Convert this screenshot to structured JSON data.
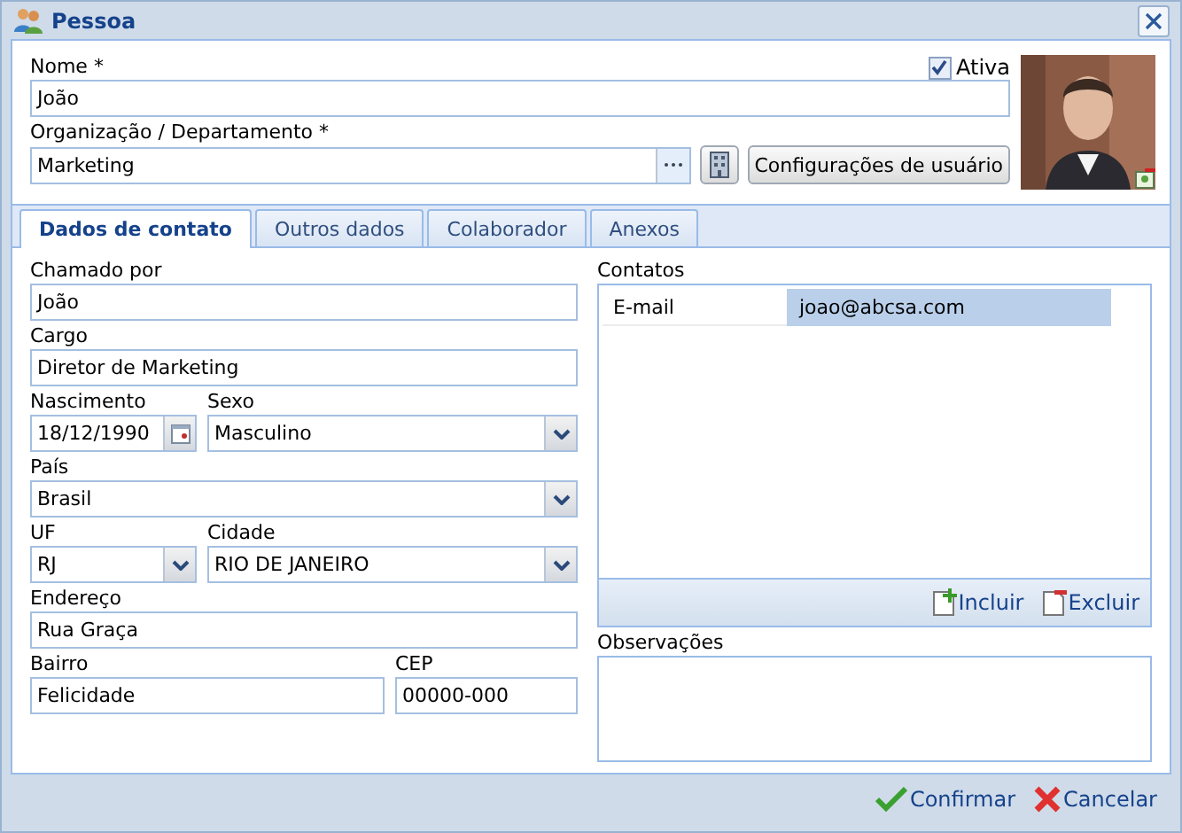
{
  "window": {
    "title": "Pessoa"
  },
  "header": {
    "name": {
      "label": "Nome *",
      "value": "João"
    },
    "active": {
      "label": "Ativa",
      "checked": true
    },
    "organization": {
      "label": "Organização / Departamento *",
      "value": "Marketing",
      "button": "Configurações de usuário"
    }
  },
  "tabs": [
    {
      "label": "Dados de contato",
      "selected": true
    },
    {
      "label": "Outros dados",
      "selected": false
    },
    {
      "label": "Colaborador",
      "selected": false
    },
    {
      "label": "Anexos",
      "selected": false
    }
  ],
  "form_rows": [
    [
      {
        "label": "Chamado por",
        "value": "João",
        "kind": "text"
      }
    ],
    [
      {
        "label": "Cargo",
        "value": "Diretor de Marketing",
        "kind": "text"
      }
    ],
    [
      {
        "label": "Nascimento",
        "value": "18/12/1990",
        "kind": "date"
      },
      {
        "label": "Sexo",
        "value": "Masculino",
        "kind": "select"
      }
    ],
    [
      {
        "label": "País",
        "value": "Brasil",
        "kind": "select"
      }
    ],
    [
      {
        "label": "UF",
        "value": "RJ",
        "kind": "select"
      },
      {
        "label": "Cidade",
        "value": "RIO DE JANEIRO",
        "kind": "select"
      }
    ],
    [
      {
        "label": "Endereço",
        "value": "Rua Graça",
        "kind": "text"
      }
    ],
    [
      {
        "label": "Bairro",
        "value": "Felicidade",
        "kind": "text"
      },
      {
        "label": "CEP",
        "value": "00000-000",
        "kind": "text"
      }
    ]
  ],
  "contacts": {
    "label": "Contatos",
    "rows": [
      {
        "type": "E-mail",
        "value": "joao@abcsa.com",
        "selected": true
      }
    ],
    "add": "Incluir",
    "remove": "Excluir"
  },
  "notes": {
    "label": "Observações"
  },
  "footer": {
    "confirm": "Confirmar",
    "cancel": "Cancelar"
  }
}
